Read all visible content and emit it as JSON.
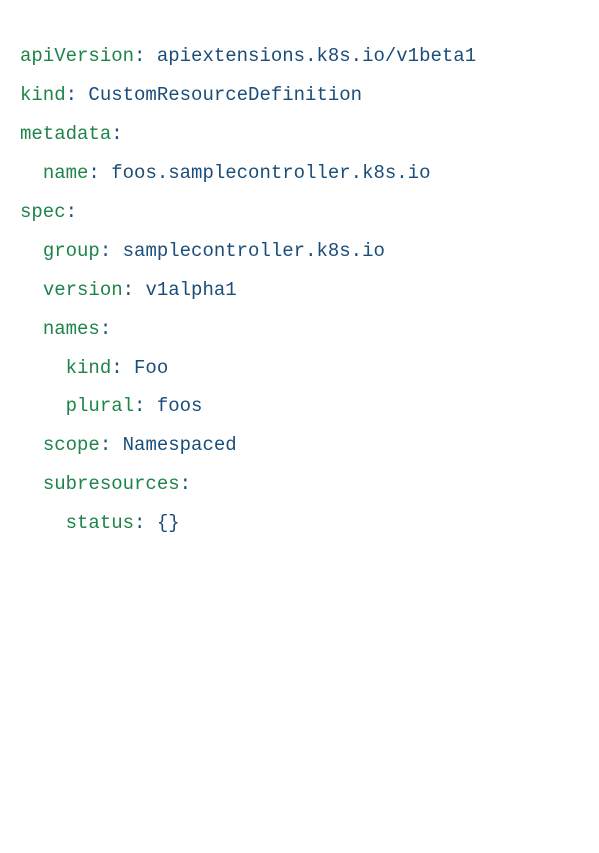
{
  "yaml": {
    "apiVersion": "apiextensions.k8s.io/v1beta1",
    "kind": "CustomResourceDefinition",
    "metadata": {
      "name": "foos.samplecontroller.k8s.io"
    },
    "spec": {
      "group": "samplecontroller.k8s.io",
      "version": "v1alpha1",
      "names": {
        "kind": "Foo",
        "plural": "foos"
      },
      "scope": "Namespaced",
      "subresources": {
        "status": "{}"
      }
    }
  },
  "palette": {
    "keyColor": "#1e8449",
    "valueColor": "#1a4d7a"
  }
}
